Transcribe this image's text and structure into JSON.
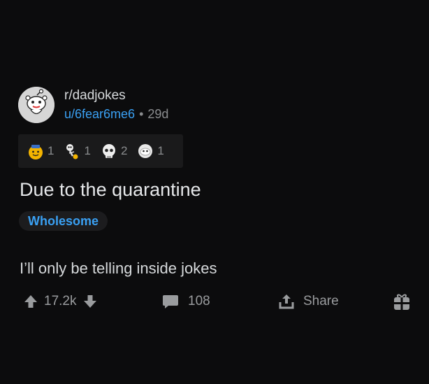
{
  "post": {
    "subreddit": "r/dadjokes",
    "username": "u/6fear6me6",
    "separator": "•",
    "age": "29d",
    "title": "Due to the quarantine",
    "flair": "Wholesome",
    "body": "I’ll only be telling inside jokes"
  },
  "awards": [
    {
      "icon": "gold-wholesome-award-icon",
      "count": "1"
    },
    {
      "icon": "skeleton-award-icon",
      "count": "1"
    },
    {
      "icon": "skull-award-icon",
      "count": "2"
    },
    {
      "icon": "silver-award-icon",
      "count": "1"
    }
  ],
  "actions": {
    "score": "17.2k",
    "comments": "108",
    "share": "Share"
  },
  "colors": {
    "background": "#0c0c0d",
    "link_blue": "#3aa0f3",
    "muted": "#8a8c8e"
  }
}
